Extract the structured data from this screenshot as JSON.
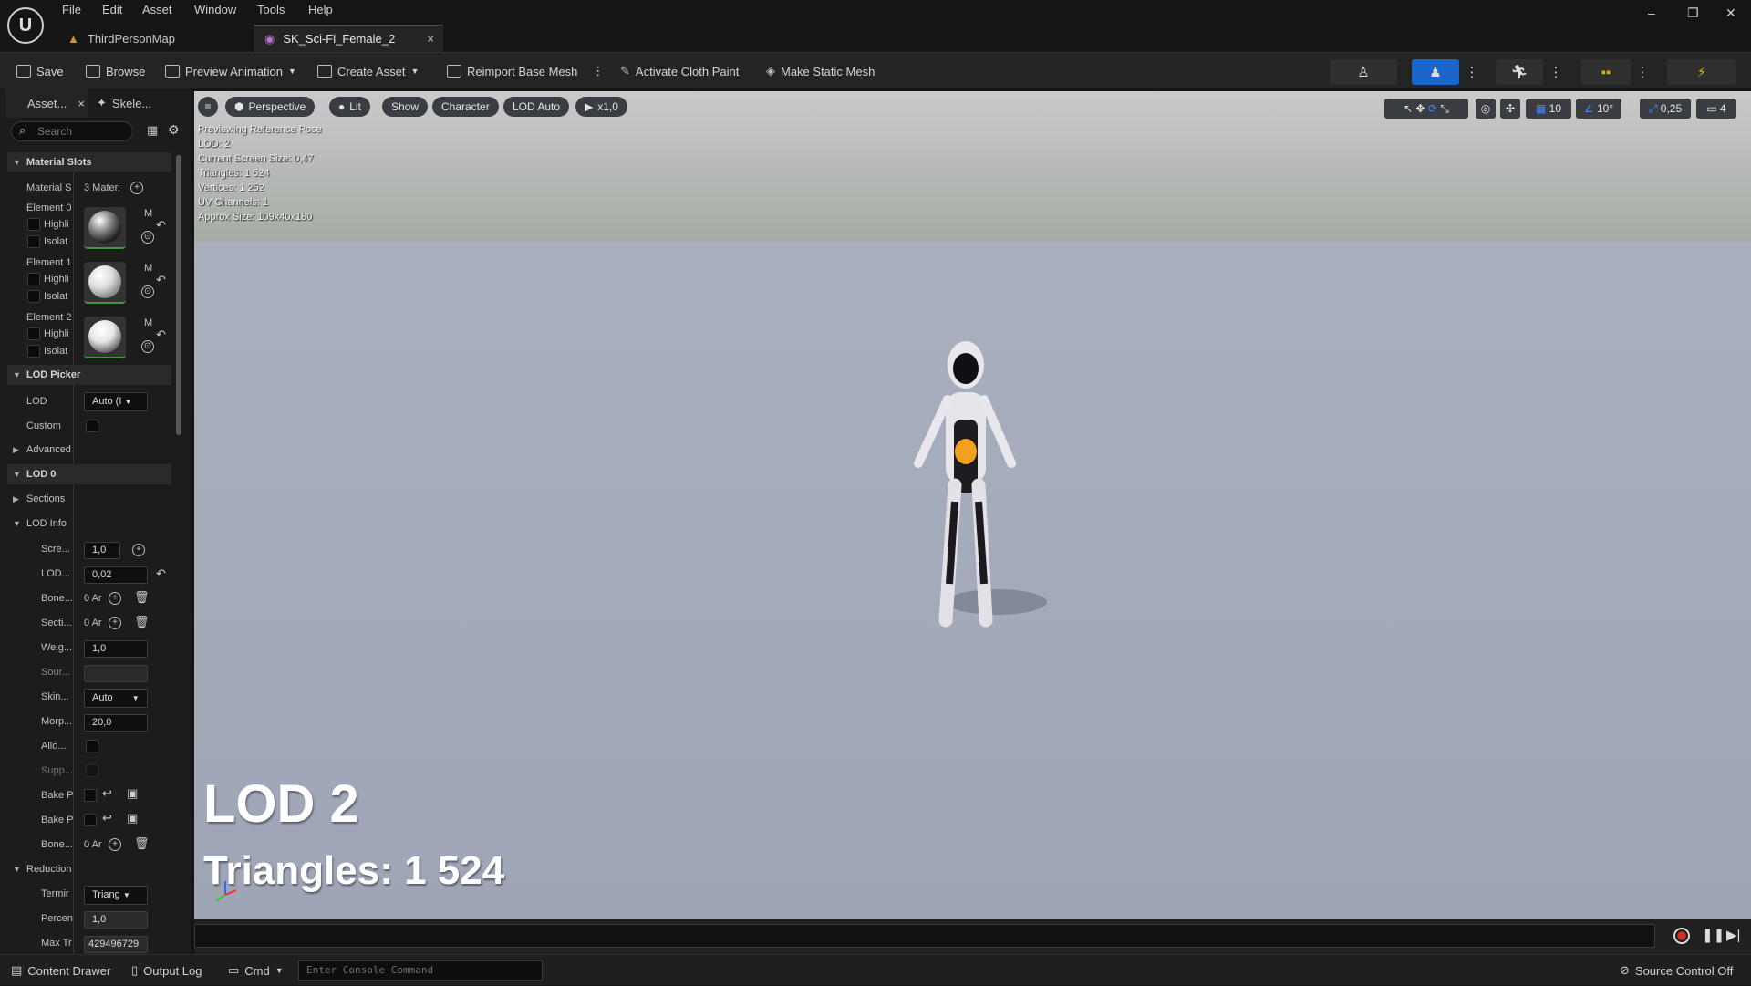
{
  "menu": [
    "File",
    "Edit",
    "Asset",
    "Window",
    "Tools",
    "Help"
  ],
  "tabs": [
    {
      "label": "ThirdPersonMap"
    },
    {
      "label": "SK_Sci-Fi_Female_2",
      "close": "×"
    }
  ],
  "window_controls": {
    "minimize": "–",
    "restore": "❐",
    "close": "✕"
  },
  "toolbar": {
    "save": "Save",
    "browse": "Browse",
    "preview_animation": "Preview Animation",
    "create_asset": "Create Asset",
    "reimport": "Reimport Base Mesh",
    "cloth_paint": "Activate Cloth Paint",
    "static_mesh": "Make Static Mesh",
    "more": "⋮"
  },
  "left_panel": {
    "tab_asset": "Asset...",
    "tab_close": "×",
    "tab_skeleton": "Skele...",
    "search_placeholder": "Search",
    "material_slots": {
      "header": "Material Slots",
      "slots_label": "Material S",
      "slots_value": "3 Materi",
      "elements": [
        {
          "label": "Element 0",
          "highlight": "Highli",
          "isolate": "Isolat",
          "m": "M"
        },
        {
          "label": "Element 1",
          "highlight": "Highli",
          "isolate": "Isolat",
          "m": "M"
        },
        {
          "label": "Element 2",
          "highlight": "Highli",
          "isolate": "Isolat",
          "m": "M"
        }
      ]
    },
    "lod_picker": {
      "header": "LOD Picker",
      "lod_label": "LOD",
      "lod_value": "Auto (I",
      "custom_label": "Custom"
    },
    "advanced": "Advanced",
    "lod0": "LOD 0",
    "sections": "Sections",
    "lod_info": {
      "header": "LOD Info",
      "rows": [
        {
          "label": "Scre...",
          "value": "1,0"
        },
        {
          "label": "LOD...",
          "value": "0,02"
        },
        {
          "label": "Bone...",
          "value": "0 Ar"
        },
        {
          "label": "Secti...",
          "value": "0 Ar"
        },
        {
          "label": "Weig...",
          "value": "1,0"
        },
        {
          "label": "Sour...",
          "value": ""
        },
        {
          "label": "Skin...",
          "value": "Auto"
        },
        {
          "label": "Morp...",
          "value": "20,0"
        },
        {
          "label": "Allo...",
          "value": ""
        },
        {
          "label": "Supp...",
          "value": ""
        },
        {
          "label": "Bake P",
          "value": ""
        },
        {
          "label": "Bake P",
          "value": ""
        },
        {
          "label": "Bone...",
          "value": "0 Ar"
        }
      ]
    },
    "reduction": {
      "header": "Reduction",
      "rows": [
        {
          "label": "Termir",
          "value": "Triang"
        },
        {
          "label": "Percen",
          "value": "1,0"
        },
        {
          "label": "Max Tr",
          "value": "429496729"
        }
      ]
    }
  },
  "viewport": {
    "buttons": {
      "menu": "≡",
      "perspective": "Perspective",
      "lit": "Lit",
      "show": "Show",
      "character": "Character",
      "lod": "LOD Auto",
      "speed": "x1,0"
    },
    "stats": [
      "Previewing Reference Pose",
      "LOD: 2",
      "Current Screen Size: 0,47",
      "Triangles: 1 524",
      "Vertices: 1 252",
      "UV Channels: 1",
      "Approx Size: 109x40x180"
    ],
    "overlay_lod": "LOD 2",
    "overlay_triangles": "Triangles: 1 524",
    "right_controls": {
      "grid": "10",
      "angle": "10°",
      "scale": "0,25",
      "camera": "4"
    }
  },
  "statusbar": {
    "content_drawer": "Content Drawer",
    "output_log": "Output Log",
    "cmd": "Cmd",
    "console_placeholder": "Enter Console Command",
    "source_control": "Source Control Off"
  },
  "colors": {
    "accent_blue": "#1b64c8",
    "bg": "#151515",
    "panel": "#1c1c1c",
    "record_red": "#d62b2b"
  }
}
